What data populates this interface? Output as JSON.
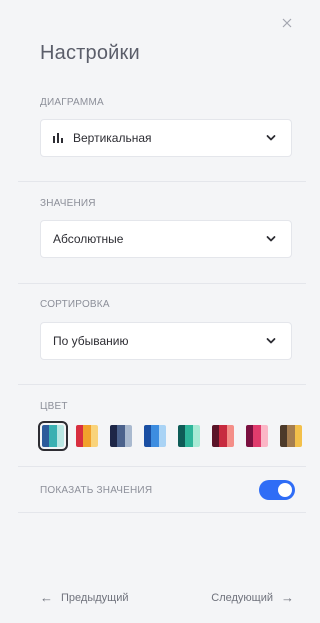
{
  "header": {
    "title": "Настройки"
  },
  "chart_type": {
    "label": "ДИАГРАММА",
    "value": "Вертикальная"
  },
  "values": {
    "label": "ЗНАЧЕНИЯ",
    "value": "Абсолютные"
  },
  "sorting": {
    "label": "СОРТИРОВКА",
    "value": "По убыванию"
  },
  "color": {
    "label": "ЦВЕТ",
    "palettes": [
      {
        "selected": true,
        "colors": [
          "#2c5b9b",
          "#3ab0b2",
          "#b9e6e3"
        ]
      },
      {
        "selected": false,
        "colors": [
          "#d82f3f",
          "#f1a12c",
          "#f9d37b"
        ]
      },
      {
        "selected": false,
        "colors": [
          "#1d2647",
          "#4b628c",
          "#a9b9cf"
        ]
      },
      {
        "selected": false,
        "colors": [
          "#1a4fa3",
          "#3d8de0",
          "#a9d3f5"
        ]
      },
      {
        "selected": false,
        "colors": [
          "#0e5c57",
          "#2eb59a",
          "#a8ead5"
        ]
      },
      {
        "selected": false,
        "colors": [
          "#5a1428",
          "#c72a3f",
          "#f48e88"
        ]
      },
      {
        "selected": false,
        "colors": [
          "#7a1040",
          "#e03c6d",
          "#fbb6c6"
        ]
      },
      {
        "selected": false,
        "colors": [
          "#4c3a2a",
          "#a47d4f",
          "#f3c04a"
        ]
      }
    ]
  },
  "show_values": {
    "label": "ПОКАЗАТЬ ЗНАЧЕНИЯ",
    "enabled": true
  },
  "footer": {
    "prev_label": "Предыдущий",
    "next_label": "Следующий"
  },
  "colors": {
    "accent": "#2f6df6",
    "bg": "#f4f5f7"
  }
}
